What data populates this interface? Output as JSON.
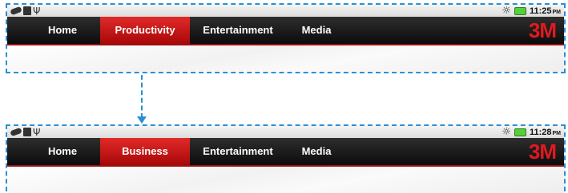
{
  "screens": [
    {
      "status": {
        "left_icons": [
          "usb-device-icon",
          "sd-card-icon",
          "usb-icon"
        ],
        "right_icons": [
          "brightness-icon",
          "battery-icon"
        ],
        "time": "11:25",
        "ampm": "PM"
      },
      "nav": {
        "items": [
          {
            "label": "Home"
          },
          {
            "label": "Productivity",
            "active": true
          },
          {
            "label": "Entertainment"
          },
          {
            "label": "Media"
          }
        ],
        "logo": "3M"
      }
    },
    {
      "status": {
        "left_icons": [
          "usb-device-icon",
          "sd-card-icon",
          "usb-icon"
        ],
        "right_icons": [
          "brightness-icon",
          "battery-icon"
        ],
        "time": "11:28",
        "ampm": "PM"
      },
      "nav": {
        "items": [
          {
            "label": "Home"
          },
          {
            "label": "Business",
            "active": true
          },
          {
            "label": "Entertainment"
          },
          {
            "label": "Media"
          }
        ],
        "logo": "3M"
      }
    }
  ],
  "colors": {
    "accent_red": "#e1191e",
    "dashed_frame": "#2a8fd2",
    "nav_background": "#1a1a1a"
  }
}
